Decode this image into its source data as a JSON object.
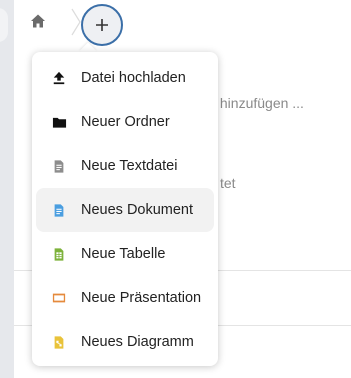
{
  "background": {
    "text_1": "ks hinzufügen ...",
    "text_2": "tet"
  },
  "menu": {
    "items": [
      {
        "id": "upload",
        "label": "Datei hochladen",
        "icon": "upload-icon",
        "color": "#111111"
      },
      {
        "id": "new-folder",
        "label": "Neuer Ordner",
        "icon": "folder-icon",
        "color": "#111111"
      },
      {
        "id": "new-textfile",
        "label": "Neue Textdatei",
        "icon": "text-file-icon",
        "color": "#8d8d8d"
      },
      {
        "id": "new-document",
        "label": "Neues Dokument",
        "icon": "document-icon",
        "color": "#4a9ee0",
        "active": true
      },
      {
        "id": "new-spreadsheet",
        "label": "Neue Tabelle",
        "icon": "spreadsheet-icon",
        "color": "#7db23b"
      },
      {
        "id": "new-presentation",
        "label": "Neue Präsentation",
        "icon": "presentation-icon",
        "color": "#e58a3c"
      },
      {
        "id": "new-diagram",
        "label": "Neues Diagramm",
        "icon": "diagram-icon",
        "color": "#e9c33a"
      }
    ]
  },
  "colors": {
    "accent_ring": "#3b6fa8",
    "hover_bg": "#f2f2f2"
  }
}
